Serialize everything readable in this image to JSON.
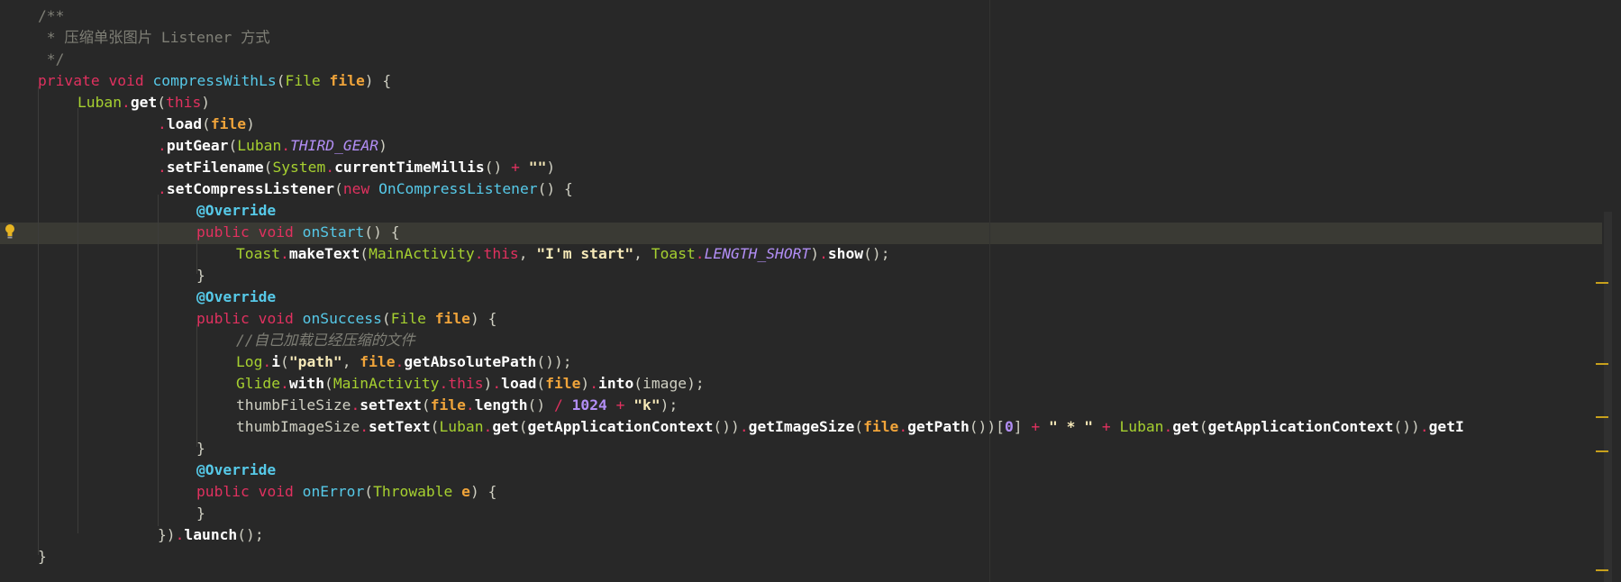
{
  "editor": {
    "lines": [
      [
        {
          "t": "c",
          "v": "/**"
        }
      ],
      [
        {
          "t": "c",
          "v": " * 压缩单张图片 Listener 方式"
        }
      ],
      [
        {
          "t": "c",
          "v": " */"
        }
      ],
      [
        {
          "t": "k",
          "v": "private"
        },
        {
          "t": "pl",
          "v": " "
        },
        {
          "t": "k",
          "v": "void"
        },
        {
          "t": "pl",
          "v": " "
        },
        {
          "t": "f",
          "v": "compressWithLs"
        },
        {
          "t": "pl",
          "v": "("
        },
        {
          "t": "t",
          "v": "File"
        },
        {
          "t": "pl",
          "v": " "
        },
        {
          "t": "p",
          "v": "file"
        },
        {
          "t": "pl",
          "v": ") {"
        }
      ],
      [
        {
          "t": "t",
          "v": "Luban"
        },
        {
          "t": "o",
          "v": "."
        },
        {
          "t": "m",
          "v": "get"
        },
        {
          "t": "pl",
          "v": "("
        },
        {
          "t": "k",
          "v": "this"
        },
        {
          "t": "pl",
          "v": ")"
        }
      ],
      [
        {
          "t": "o",
          "v": "."
        },
        {
          "t": "m",
          "v": "load"
        },
        {
          "t": "pl",
          "v": "("
        },
        {
          "t": "p",
          "v": "file"
        },
        {
          "t": "pl",
          "v": ")"
        }
      ],
      [
        {
          "t": "o",
          "v": "."
        },
        {
          "t": "m",
          "v": "putGear"
        },
        {
          "t": "pl",
          "v": "("
        },
        {
          "t": "t",
          "v": "Luban"
        },
        {
          "t": "o",
          "v": "."
        },
        {
          "t": "cs",
          "v": "THIRD_GEAR"
        },
        {
          "t": "pl",
          "v": ")"
        }
      ],
      [
        {
          "t": "o",
          "v": "."
        },
        {
          "t": "m",
          "v": "setFilename"
        },
        {
          "t": "pl",
          "v": "("
        },
        {
          "t": "t",
          "v": "System"
        },
        {
          "t": "o",
          "v": "."
        },
        {
          "t": "m",
          "v": "currentTimeMillis"
        },
        {
          "t": "pl",
          "v": "() "
        },
        {
          "t": "o",
          "v": "+"
        },
        {
          "t": "pl",
          "v": " "
        },
        {
          "t": "s",
          "v": "\"\""
        },
        {
          "t": "pl",
          "v": ")"
        }
      ],
      [
        {
          "t": "o",
          "v": "."
        },
        {
          "t": "m",
          "v": "setCompressListener"
        },
        {
          "t": "pl",
          "v": "("
        },
        {
          "t": "k",
          "v": "new"
        },
        {
          "t": "pl",
          "v": " "
        },
        {
          "t": "f",
          "v": "OnCompressListener"
        },
        {
          "t": "pl",
          "v": "() {"
        }
      ],
      [
        {
          "t": "a",
          "v": "@Override"
        }
      ],
      [
        {
          "t": "k",
          "v": "public"
        },
        {
          "t": "pl",
          "v": " "
        },
        {
          "t": "k",
          "v": "void"
        },
        {
          "t": "pl",
          "v": " "
        },
        {
          "t": "f",
          "v": "onStart"
        },
        {
          "t": "pl",
          "v": "() {"
        }
      ],
      [
        {
          "t": "t",
          "v": "Toast"
        },
        {
          "t": "o",
          "v": "."
        },
        {
          "t": "m",
          "v": "makeText"
        },
        {
          "t": "pl",
          "v": "("
        },
        {
          "t": "t",
          "v": "MainActivity"
        },
        {
          "t": "o",
          "v": "."
        },
        {
          "t": "k",
          "v": "this"
        },
        {
          "t": "pl",
          "v": ", "
        },
        {
          "t": "s",
          "v": "\"I'm start\""
        },
        {
          "t": "pl",
          "v": ", "
        },
        {
          "t": "t",
          "v": "Toast"
        },
        {
          "t": "o",
          "v": "."
        },
        {
          "t": "cs",
          "v": "LENGTH_SHORT"
        },
        {
          "t": "pl",
          "v": ")"
        },
        {
          "t": "o",
          "v": "."
        },
        {
          "t": "m",
          "v": "show"
        },
        {
          "t": "pl",
          "v": "();"
        }
      ],
      [
        {
          "t": "pl",
          "v": "}"
        }
      ],
      [
        {
          "t": "a",
          "v": "@Override"
        }
      ],
      [
        {
          "t": "k",
          "v": "public"
        },
        {
          "t": "pl",
          "v": " "
        },
        {
          "t": "k",
          "v": "void"
        },
        {
          "t": "pl",
          "v": " "
        },
        {
          "t": "f",
          "v": "onSuccess"
        },
        {
          "t": "pl",
          "v": "("
        },
        {
          "t": "t",
          "v": "File"
        },
        {
          "t": "pl",
          "v": " "
        },
        {
          "t": "p",
          "v": "file"
        },
        {
          "t": "pl",
          "v": ") {"
        }
      ],
      [
        {
          "t": "ci",
          "v": "//自己加载已经压缩的文件"
        }
      ],
      [
        {
          "t": "t",
          "v": "Log"
        },
        {
          "t": "o",
          "v": "."
        },
        {
          "t": "m",
          "v": "i"
        },
        {
          "t": "pl",
          "v": "("
        },
        {
          "t": "s",
          "v": "\"path\""
        },
        {
          "t": "pl",
          "v": ", "
        },
        {
          "t": "p",
          "v": "file"
        },
        {
          "t": "o",
          "v": "."
        },
        {
          "t": "m",
          "v": "getAbsolutePath"
        },
        {
          "t": "pl",
          "v": "());"
        }
      ],
      [
        {
          "t": "t",
          "v": "Glide"
        },
        {
          "t": "o",
          "v": "."
        },
        {
          "t": "m",
          "v": "with"
        },
        {
          "t": "pl",
          "v": "("
        },
        {
          "t": "t",
          "v": "MainActivity"
        },
        {
          "t": "o",
          "v": "."
        },
        {
          "t": "k",
          "v": "this"
        },
        {
          "t": "pl",
          "v": ")"
        },
        {
          "t": "o",
          "v": "."
        },
        {
          "t": "m",
          "v": "load"
        },
        {
          "t": "pl",
          "v": "("
        },
        {
          "t": "p",
          "v": "file"
        },
        {
          "t": "pl",
          "v": ")"
        },
        {
          "t": "o",
          "v": "."
        },
        {
          "t": "m",
          "v": "into"
        },
        {
          "t": "pl",
          "v": "(image);"
        }
      ],
      [
        {
          "t": "pl",
          "v": "thumbFileSize"
        },
        {
          "t": "o",
          "v": "."
        },
        {
          "t": "m",
          "v": "setText"
        },
        {
          "t": "pl",
          "v": "("
        },
        {
          "t": "p",
          "v": "file"
        },
        {
          "t": "o",
          "v": "."
        },
        {
          "t": "m",
          "v": "length"
        },
        {
          "t": "pl",
          "v": "() "
        },
        {
          "t": "o",
          "v": "/"
        },
        {
          "t": "pl",
          "v": " "
        },
        {
          "t": "n",
          "v": "1024"
        },
        {
          "t": "pl",
          "v": " "
        },
        {
          "t": "o",
          "v": "+"
        },
        {
          "t": "pl",
          "v": " "
        },
        {
          "t": "s",
          "v": "\"k\""
        },
        {
          "t": "pl",
          "v": ");"
        }
      ],
      [
        {
          "t": "pl",
          "v": "thumbImageSize"
        },
        {
          "t": "o",
          "v": "."
        },
        {
          "t": "m",
          "v": "setText"
        },
        {
          "t": "pl",
          "v": "("
        },
        {
          "t": "t",
          "v": "Luban"
        },
        {
          "t": "o",
          "v": "."
        },
        {
          "t": "m",
          "v": "get"
        },
        {
          "t": "pl",
          "v": "("
        },
        {
          "t": "m",
          "v": "getApplicationContext"
        },
        {
          "t": "pl",
          "v": "())"
        },
        {
          "t": "o",
          "v": "."
        },
        {
          "t": "m",
          "v": "getImageSize"
        },
        {
          "t": "pl",
          "v": "("
        },
        {
          "t": "p",
          "v": "file"
        },
        {
          "t": "o",
          "v": "."
        },
        {
          "t": "m",
          "v": "getPath"
        },
        {
          "t": "pl",
          "v": "())["
        },
        {
          "t": "n",
          "v": "0"
        },
        {
          "t": "pl",
          "v": "] "
        },
        {
          "t": "o",
          "v": "+"
        },
        {
          "t": "pl",
          "v": " "
        },
        {
          "t": "s",
          "v": "\" * \""
        },
        {
          "t": "pl",
          "v": " "
        },
        {
          "t": "o",
          "v": "+"
        },
        {
          "t": "pl",
          "v": " "
        },
        {
          "t": "t",
          "v": "Luban"
        },
        {
          "t": "o",
          "v": "."
        },
        {
          "t": "m",
          "v": "get"
        },
        {
          "t": "pl",
          "v": "("
        },
        {
          "t": "m",
          "v": "getApplicationContext"
        },
        {
          "t": "pl",
          "v": "())"
        },
        {
          "t": "o",
          "v": "."
        },
        {
          "t": "m",
          "v": "getI"
        }
      ],
      [
        {
          "t": "pl",
          "v": "}"
        }
      ],
      [
        {
          "t": "a",
          "v": "@Override"
        }
      ],
      [
        {
          "t": "k",
          "v": "public"
        },
        {
          "t": "pl",
          "v": " "
        },
        {
          "t": "k",
          "v": "void"
        },
        {
          "t": "pl",
          "v": " "
        },
        {
          "t": "f",
          "v": "onError"
        },
        {
          "t": "pl",
          "v": "("
        },
        {
          "t": "t",
          "v": "Throwable"
        },
        {
          "t": "pl",
          "v": " "
        },
        {
          "t": "p",
          "v": "e"
        },
        {
          "t": "pl",
          "v": ") {"
        }
      ],
      [
        {
          "t": "pl",
          "v": "}"
        }
      ],
      [
        {
          "t": "pl",
          "v": "})"
        },
        {
          "t": "o",
          "v": "."
        },
        {
          "t": "m",
          "v": "launch"
        },
        {
          "t": "pl",
          "v": "();"
        }
      ],
      [
        {
          "t": "pl",
          "v": "}"
        }
      ]
    ]
  },
  "colors": {
    "background": "#282828",
    "current_line": "#3a3a34",
    "keyword": "#e0315f",
    "function": "#56c9e8",
    "type": "#a6d030",
    "parameter": "#f0a43a",
    "string": "#f6e9b8",
    "constant": "#b28ef5",
    "comment": "#7f7f76",
    "marker": "#c7a01c"
  },
  "icons": {
    "gutter": "lightbulb-icon"
  }
}
